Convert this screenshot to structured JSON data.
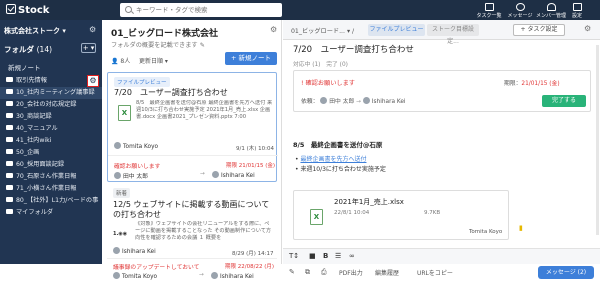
{
  "topbar": {
    "logo": "Stock",
    "search_placeholder": "キーワード・タグで検索",
    "nav": [
      "タスク一覧",
      "メッセージ",
      "メンバー管理",
      "設定"
    ]
  },
  "sidebar": {
    "org": "株式会社ストーク",
    "folders_label": "フォルダ",
    "folders_count": "(14)",
    "new_note": "新規ノート",
    "items": [
      {
        "label": "取引先情報"
      },
      {
        "label": "10_社内ミーティング議事録"
      },
      {
        "label": "20_会社の対応規定録"
      },
      {
        "label": "30_商談記録"
      },
      {
        "label": "40_マニュアル"
      },
      {
        "label": "41_社内wiki"
      },
      {
        "label": "50_企画"
      },
      {
        "label": "60_採用面談記録"
      },
      {
        "label": "70_石原さん作業日報"
      },
      {
        "label": "71_小横さん作業日報"
      },
      {
        "label": "80_【社外】L1力/ペードの事"
      },
      {
        "label": "マイフォルダ"
      }
    ]
  },
  "middle": {
    "title": "01_ビッグロード株式会社",
    "desc": "フォルダの概要を記載できます",
    "count": "8人",
    "sort": "更新日順",
    "new_note_btn": "+ 新規ノート",
    "card1": {
      "badge": "ファイルプレビュー",
      "title": "7/20　ユーザー調査打ち合わせ",
      "snippet": "8/5　最終企画書を送付@石原 最終企画書を先方へ送付 来週10/3に打ち合わせ実施予定 2021年1月_売上.xlsx 企画書.docx 企画書2021_プレゼン資料.pptx 7:00",
      "author": "Tomita Koyo",
      "date": "9/1 (木) 10:04",
      "alert": "確認お願いします",
      "due": "期限 21/01/15 (金)",
      "req_from": "田中 太郎",
      "req_to": "Ishihara Kei"
    },
    "card2": {
      "badge": "新着",
      "title": "12/5 ウェブサイトに掲載する動画についての打ち合わせ",
      "snippet": "《対象》ウェブサイトの会社リニューアルをする際に、ページに動画を掲載することなった その動画制作について方向性を確認するための会議 １ 概要を",
      "author": "Ishihara Kei",
      "date": "8/29 (月) 14:17",
      "alert": "議事録のアップデートしておいて",
      "due": "期限 22/08/22 (月)",
      "req_from": "Tomita Koyo",
      "req_to": "Ishihara Kei"
    }
  },
  "right": {
    "breadcrumb": "01_ビッグロード...",
    "tab_preview": "ファイルプレビュー",
    "tab_other": "ストーク目標設定...",
    "add_task": "+ タスク設定",
    "title": "7/20　ユーザー調査打ち合わせ",
    "sub": "対応中 (1)　完了 (0)",
    "task": {
      "state": "! 確認お願いします",
      "due_label": "期限：",
      "due": "21/01/15 (金)",
      "req_label": "依頼：",
      "req_from": "田中 太郎",
      "req_to": "Ishihara Kei",
      "done_btn": "完了する"
    },
    "section_title": "8/5　最終企画書を送付@石原",
    "bullets": [
      "最終企画書を先方へ送付",
      "来週10/3に打ち合わせ実施予定"
    ],
    "attachment": {
      "name": "2021年1月_売上.xlsx",
      "date": "22/8/1 10:04",
      "size": "9.7KB",
      "author": "Tomita Koyo"
    },
    "editor_tools": [
      "PDF出力",
      "編集履歴",
      "URLをコピー"
    ],
    "message_btn": "メッセージ (2)"
  }
}
